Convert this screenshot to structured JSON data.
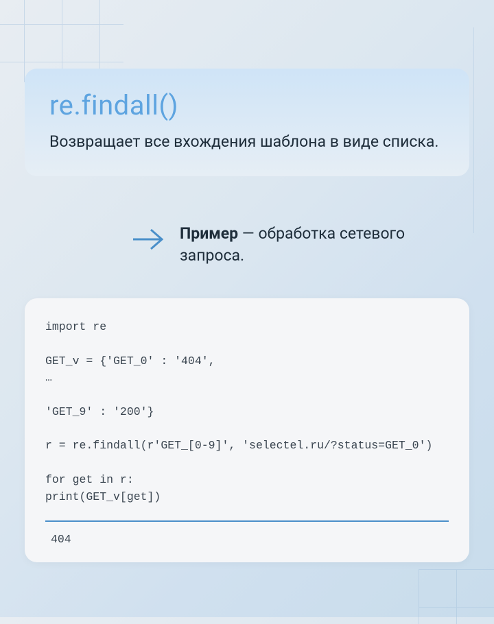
{
  "title": "re.findall()",
  "description": "Возвращает все вхождения шаблона в виде списка.",
  "example_label": "Пример",
  "example_dash": " — ",
  "example_text": "обработка сетевого запроса.",
  "code_lines": [
    "import re",
    "",
    "GET_v = {'GET_0' : '404',",
    "…",
    "",
    "'GET_9' : '200'}",
    "",
    "r = re.findall(r'GET_[0-9]', 'selectel.ru/?status=GET_0')",
    "",
    "for get in r:",
    "print(GET_v[get])"
  ],
  "output": "404"
}
